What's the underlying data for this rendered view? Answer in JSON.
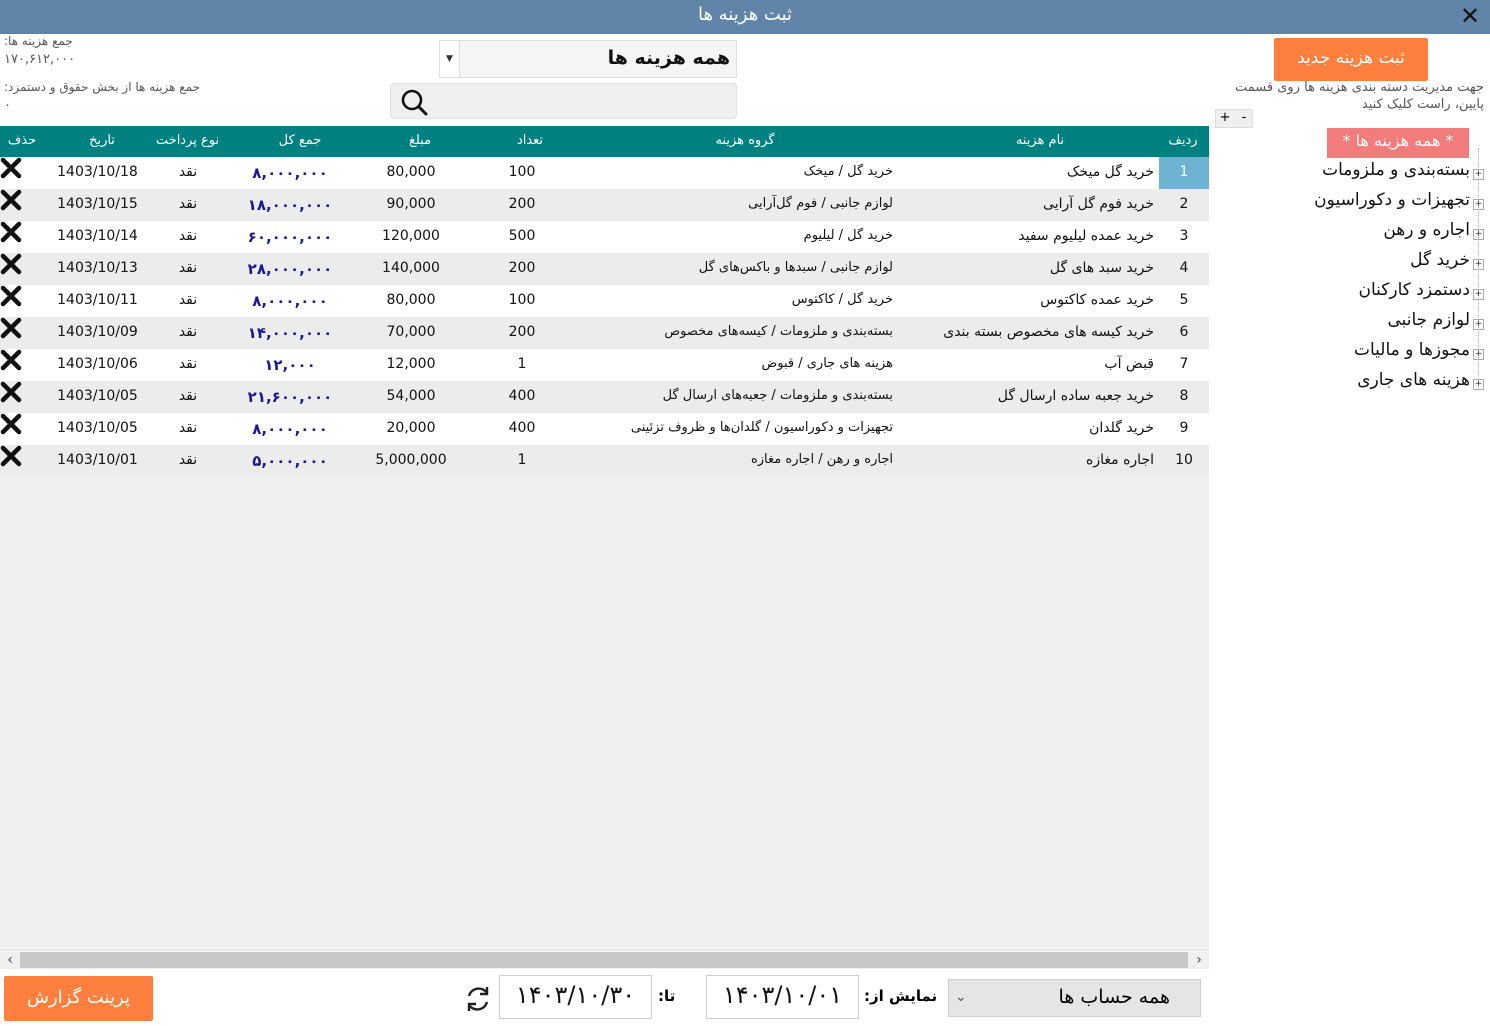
{
  "window": {
    "title": "ثبت هزینه ها",
    "close_label": "✕"
  },
  "summary": {
    "total_label": "جمع هزینه ها:",
    "total_value": "۱۷۰,۶۱۲,۰۰۰",
    "payroll_label": "جمع هزینه ها از بخش حقوق و دستمزد:",
    "payroll_value": "۰"
  },
  "filter": {
    "category": "همه هزینه ها",
    "search_placeholder": ""
  },
  "grid": {
    "columns": {
      "row": "ردیف",
      "name": "نام هزینه",
      "group": "گروه هزینه",
      "qty": "تعداد",
      "amount": "مبلغ",
      "total": "جمع کل",
      "pay_type": "نوع پرداخت",
      "date": "تاریخ",
      "delete": "حذف"
    },
    "rows": [
      {
        "idx": "1",
        "name": "خرید گل میخک",
        "group": "خرید گل / میخک",
        "qty": "100",
        "amount": "80,000",
        "total": "۸,۰۰۰,۰۰۰",
        "pay": "نقد",
        "date": "1403/10/18"
      },
      {
        "idx": "2",
        "name": "خرید فوم گل آرایی",
        "group": "لوازم جانبی / فوم گل‌آرایی",
        "qty": "200",
        "amount": "90,000",
        "total": "۱۸,۰۰۰,۰۰۰",
        "pay": "نقد",
        "date": "1403/10/15"
      },
      {
        "idx": "3",
        "name": "خرید عمده لیلیوم سفید",
        "group": "خرید گل / لیلیوم",
        "qty": "500",
        "amount": "120,000",
        "total": "۶۰,۰۰۰,۰۰۰",
        "pay": "نقد",
        "date": "1403/10/14"
      },
      {
        "idx": "4",
        "name": "خرید سبد های گل",
        "group": "لوازم جانبی / سبدها و باکس‌های گل",
        "qty": "200",
        "amount": "140,000",
        "total": "۲۸,۰۰۰,۰۰۰",
        "pay": "نقد",
        "date": "1403/10/13"
      },
      {
        "idx": "5",
        "name": "خرید عمده کاکتوس",
        "group": "خرید گل / کاکتوس",
        "qty": "100",
        "amount": "80,000",
        "total": "۸,۰۰۰,۰۰۰",
        "pay": "نقد",
        "date": "1403/10/11"
      },
      {
        "idx": "6",
        "name": "خرید کیسه های مخصوص بسته بندی",
        "group": "بسته‌بندی و ملزومات / کیسه‌های مخصوص",
        "qty": "200",
        "amount": "70,000",
        "total": "۱۴,۰۰۰,۰۰۰",
        "pay": "نقد",
        "date": "1403/10/09"
      },
      {
        "idx": "7",
        "name": "قبض آب",
        "group": "هزینه های جاری / قبوض",
        "qty": "1",
        "amount": "12,000",
        "total": "۱۲,۰۰۰",
        "pay": "نقد",
        "date": "1403/10/06"
      },
      {
        "idx": "8",
        "name": "خرید جعبه ساده ارسال گل",
        "group": "بسته‌بندی و ملزومات / جعبه‌های ارسال گل",
        "qty": "400",
        "amount": "54,000",
        "total": "۲۱,۶۰۰,۰۰۰",
        "pay": "نقد",
        "date": "1403/10/05"
      },
      {
        "idx": "9",
        "name": "خرید گلدان",
        "group": "تجهیزات و دکوراسیون / گلدان‌ها و ظروف تزئینی",
        "qty": "400",
        "amount": "20,000",
        "total": "۸,۰۰۰,۰۰۰",
        "pay": "نقد",
        "date": "1403/10/05"
      },
      {
        "idx": "10",
        "name": "اجاره مغازه",
        "group": "اجاره و رهن / اجاره مغازه",
        "qty": "1",
        "amount": "5,000,000",
        "total": "۵,۰۰۰,۰۰۰",
        "pay": "نقد",
        "date": "1403/10/01"
      }
    ]
  },
  "sidebar": {
    "new_button": "ثبت هزینه جدید",
    "hint": "جهت مدیریت دسته بندی هزینه ها روی قسمت پایین، راست کلیک کنید",
    "plus": "+",
    "minus": "-",
    "root": "* همه هزینه ها *",
    "categories": [
      "بسته‌بندی و ملزومات",
      "تجهیزات و دکوراسیون",
      "اجاره و رهن",
      "خرید گل",
      "دستمزد کارکنان",
      "لوازم جانبی",
      "مجوزها و مالیات",
      "هزینه های جاری"
    ]
  },
  "footer": {
    "print_button": "پرینت گزارش",
    "accounts": "همه حساب ها",
    "from_label": "نمایش از:",
    "from_date": "۱۴۰۳/۱۰/۰۱",
    "to_label": "تا:",
    "to_date": "۱۴۰۳/۱۰/۳۰"
  },
  "colors": {
    "titlebar": "#6185a8",
    "grid_header": "#008080",
    "accent": "#ff7f3f",
    "tree_root": "#f27b7b",
    "selected_cell": "#6fb3d2",
    "total_text": "#1a1a90"
  },
  "icons": {
    "search": "search-icon",
    "delete": "delete-x-icon",
    "refresh": "refresh-icon",
    "close": "close-icon",
    "expand": "expand-plus-icon"
  }
}
